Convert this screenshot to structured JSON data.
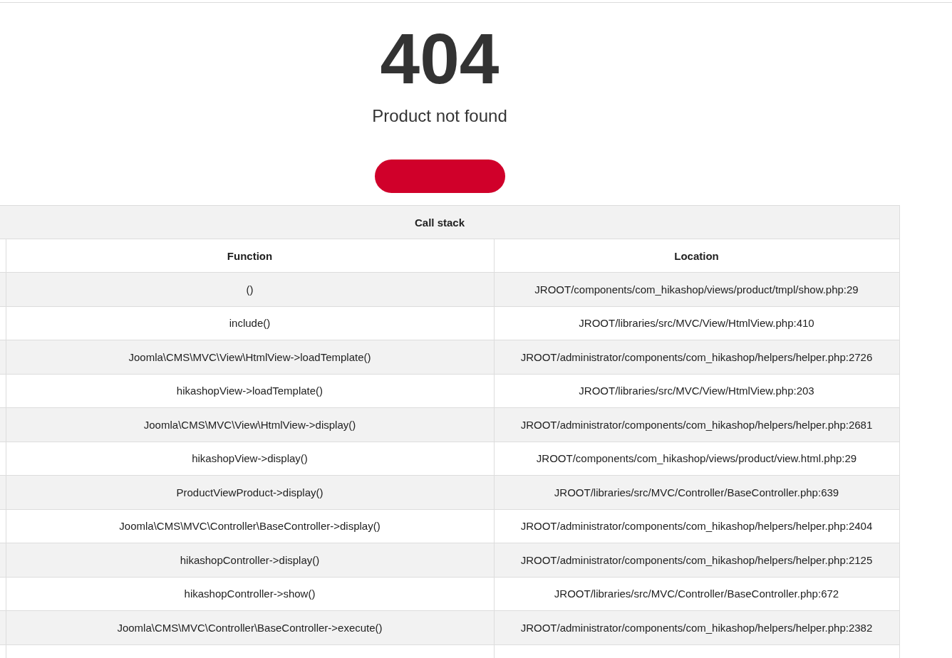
{
  "error": {
    "code": "404",
    "message": "Product not found"
  },
  "call_stack": {
    "title": "Call stack",
    "columns": [
      "Function",
      "Location"
    ],
    "rows": [
      {
        "function": "()",
        "location": "JROOT/components/com_hikashop/views/product/tmpl/show.php:29"
      },
      {
        "function": "include()",
        "location": "JROOT/libraries/src/MVC/View/HtmlView.php:410"
      },
      {
        "function": "Joomla\\CMS\\MVC\\View\\HtmlView->loadTemplate()",
        "location": "JROOT/administrator/components/com_hikashop/helpers/helper.php:2726"
      },
      {
        "function": "hikashopView->loadTemplate()",
        "location": "JROOT/libraries/src/MVC/View/HtmlView.php:203"
      },
      {
        "function": "Joomla\\CMS\\MVC\\View\\HtmlView->display()",
        "location": "JROOT/administrator/components/com_hikashop/helpers/helper.php:2681"
      },
      {
        "function": "hikashopView->display()",
        "location": "JROOT/components/com_hikashop/views/product/view.html.php:29"
      },
      {
        "function": "ProductViewProduct->display()",
        "location": "JROOT/libraries/src/MVC/Controller/BaseController.php:639"
      },
      {
        "function": "Joomla\\CMS\\MVC\\Controller\\BaseController->display()",
        "location": "JROOT/administrator/components/com_hikashop/helpers/helper.php:2404"
      },
      {
        "function": "hikashopController->display()",
        "location": "JROOT/administrator/components/com_hikashop/helpers/helper.php:2125"
      },
      {
        "function": "hikashopController->show()",
        "location": "JROOT/libraries/src/MVC/Controller/BaseController.php:672"
      },
      {
        "function": "Joomla\\CMS\\MVC\\Controller\\BaseController->execute()",
        "location": "JROOT/administrator/components/com_hikashop/helpers/helper.php:2382"
      }
    ]
  }
}
